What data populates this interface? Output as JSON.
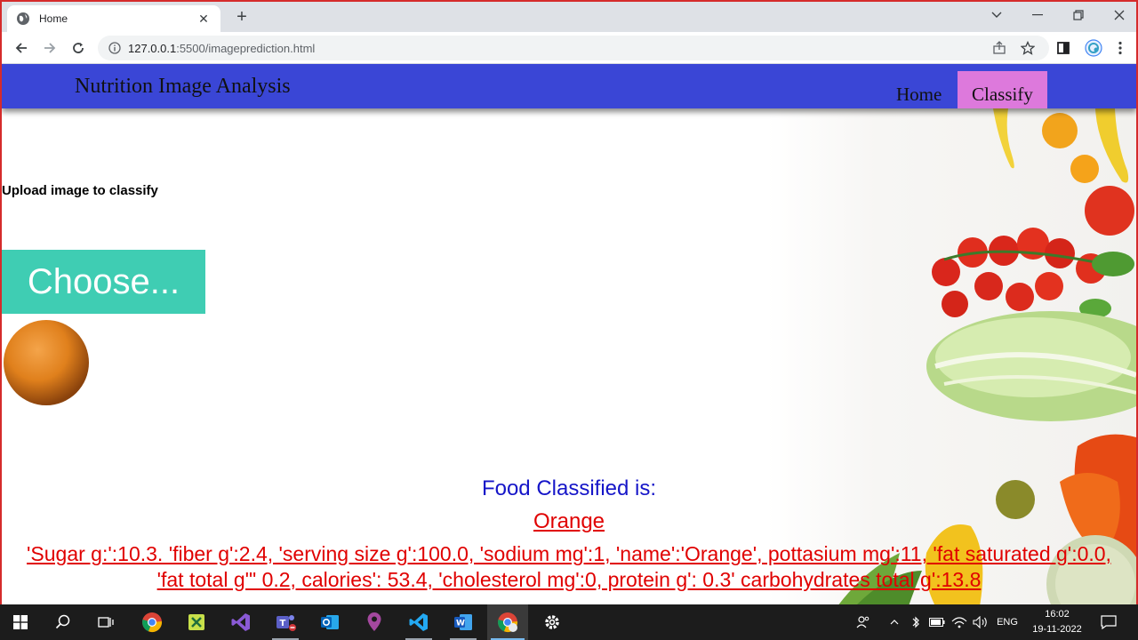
{
  "browser": {
    "tab_title": "Home",
    "url_host": "127.0.0.1",
    "url_rest": ":5500/imageprediction.html"
  },
  "navbar": {
    "brand": "Nutrition Image Analysis",
    "links": [
      {
        "label": "Home",
        "active": false
      },
      {
        "label": "Classify",
        "active": true
      }
    ],
    "bg_color": "#3a46d6",
    "active_color": "#dd79dc"
  },
  "upload": {
    "label": "Upload image to classify",
    "button_label": "Choose...",
    "button_color": "#3fcdb3"
  },
  "result": {
    "heading": "Food Classified is:",
    "food": "Orange",
    "details_line1": "'Sugar g:':10.3. 'fiber g':2.4, 'serving size g':100.0, 'sodium mg':1, 'name':'Orange', pottasium mg':11, 'fat saturated g':0.0,",
    "details_line2": "'fat total g'\" 0.2, calories': 53.4, 'cholesterol mg':0, protein g': 0.3' carbohydrates total g':13.8"
  },
  "taskbar": {
    "language": "ENG",
    "time": "16:02",
    "date": "19-11-2022"
  }
}
